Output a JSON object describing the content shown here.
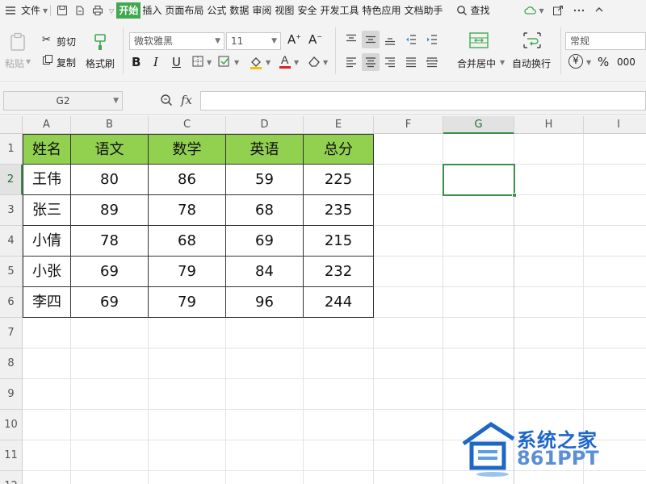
{
  "menubar": {
    "file": "文件",
    "tabs": [
      "开始",
      "插入",
      "页面布局",
      "公式",
      "数据",
      "审阅",
      "视图",
      "安全",
      "开发工具",
      "特色应用",
      "文档助手"
    ],
    "active_tab": "开始",
    "search": "查找"
  },
  "ribbon": {
    "paste": "粘贴",
    "cut": "剪切",
    "copy": "复制",
    "format_painter": "格式刷",
    "font_name": "微软雅黑",
    "font_size": "11",
    "merge_center": "合并居中",
    "wrap_text": "自动换行",
    "number_format": "常规",
    "currency_symbol": "¥",
    "percent_symbol": "%",
    "comma_symbol": "000"
  },
  "formula_bar": {
    "name_box": "G2",
    "fx": "fx"
  },
  "grid": {
    "columns": [
      "A",
      "B",
      "C",
      "D",
      "E",
      "F",
      "G",
      "H",
      "I"
    ],
    "rows": [
      "1",
      "2",
      "3",
      "4",
      "5",
      "6",
      "7",
      "8",
      "9",
      "10",
      "11",
      "12"
    ],
    "selected_cell": "G2",
    "header_color": "#92d050",
    "selection_color": "#3b8f4a"
  },
  "table": {
    "headers": [
      "姓名",
      "语文",
      "数学",
      "英语",
      "总分"
    ],
    "rows": [
      [
        "王伟",
        "80",
        "86",
        "59",
        "225"
      ],
      [
        "张三",
        "89",
        "78",
        "68",
        "235"
      ],
      [
        "小倩",
        "78",
        "68",
        "69",
        "215"
      ],
      [
        "小张",
        "69",
        "79",
        "84",
        "232"
      ],
      [
        "李四",
        "69",
        "79",
        "96",
        "244"
      ]
    ]
  },
  "watermark": {
    "title": "系统之家",
    "subtitle": "861PPT"
  }
}
